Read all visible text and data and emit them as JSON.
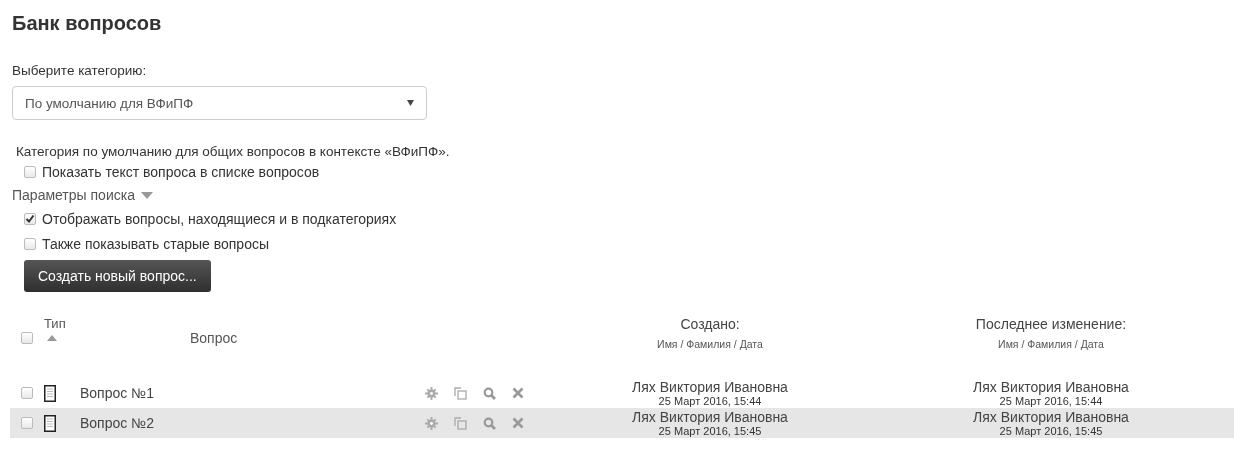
{
  "page_title": "Банк вопросов",
  "category": {
    "label": "Выберите категорию:",
    "value": "По умолчанию для ВФиПФ",
    "description": "Категория по умолчанию для общих вопросов в контексте «ВФиПФ»."
  },
  "show_question_text": {
    "label": "Показать текст вопроса в списке вопросов",
    "checked": false
  },
  "search_options": {
    "label": "Параметры поиска",
    "expanded": true,
    "options": [
      {
        "label": "Отображать вопросы, находящиеся и в подкатегориях",
        "checked": true
      },
      {
        "label": "Также показывать старые вопросы",
        "checked": false
      }
    ]
  },
  "create_button": "Создать новый вопрос...",
  "table": {
    "select_all_checked": false,
    "type_header": "Тип",
    "question_header": "Вопрос",
    "created_header": "Создано:",
    "created_sub": "Имя / Фамилия / Дата",
    "modified_header": "Последнее изменение:",
    "modified_sub": "Имя / Фамилия / Дата",
    "rows": [
      {
        "checked": false,
        "highlighted": false,
        "name": "Вопрос №1",
        "created_by": "Лях Виктория Ивановна",
        "created_date": "25 Март 2016, 15:44",
        "modified_by": "Лях Виктория Ивановна",
        "modified_date": "25 Март 2016, 15:44"
      },
      {
        "checked": false,
        "highlighted": true,
        "name": "Вопрос №2",
        "created_by": "Лях Виктория Ивановна",
        "created_date": "25 Март 2016, 15:45",
        "modified_by": "Лях Виктория Ивановна",
        "modified_date": "25 Март 2016, 15:45"
      }
    ]
  }
}
